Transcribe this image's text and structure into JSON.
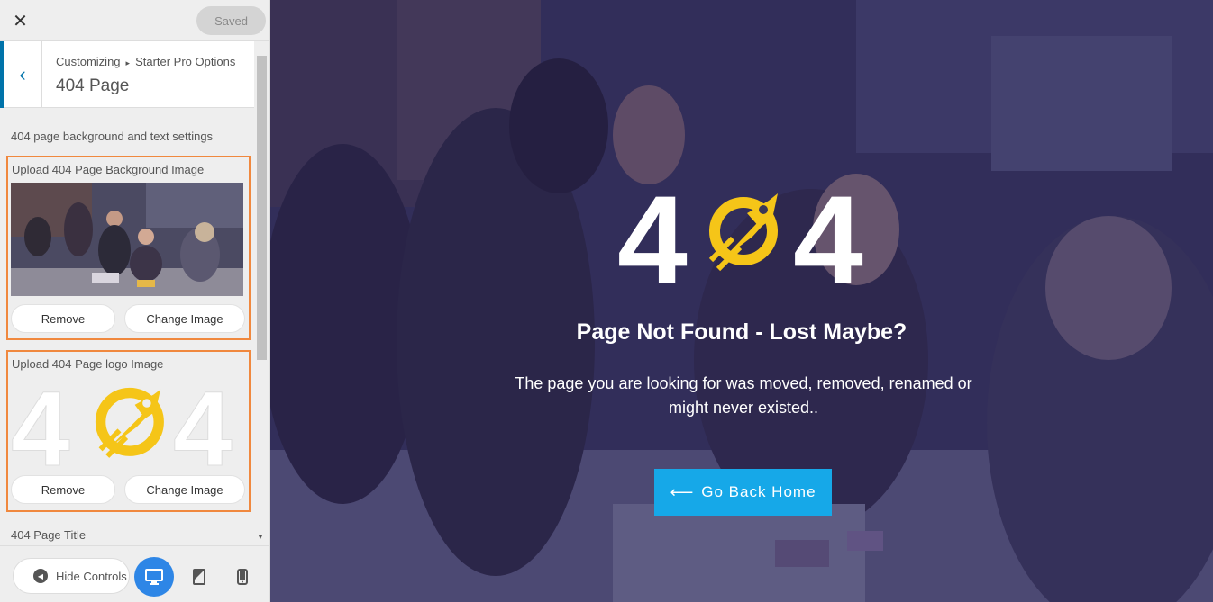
{
  "topbar": {
    "close_icon": "close-icon",
    "saved_label": "Saved"
  },
  "section": {
    "breadcrumb_root": "Customizing",
    "breadcrumb_child": "Starter Pro Options",
    "title": "404 Page"
  },
  "panel": {
    "description": "404 page background and text settings",
    "bg_upload": {
      "label": "Upload 404 Page Background Image",
      "remove": "Remove",
      "change": "Change Image"
    },
    "logo_upload": {
      "label": "Upload 404 Page logo Image",
      "remove": "Remove",
      "change": "Change Image"
    },
    "title_label": "404 Page Title"
  },
  "footer": {
    "hide_controls": "Hide Controls"
  },
  "preview": {
    "logo_left": "4",
    "logo_right": "4",
    "headline": "Page Not Found - Lost Maybe?",
    "message": "The page you are looking for was moved, removed, renamed or might never existed..",
    "button": "Go Back Home"
  },
  "colors": {
    "accent": "#0073aa",
    "highlight": "#f0883e",
    "button": "#16a8e8",
    "rocket": "#f5c518",
    "active_device": "#2e86e6"
  }
}
